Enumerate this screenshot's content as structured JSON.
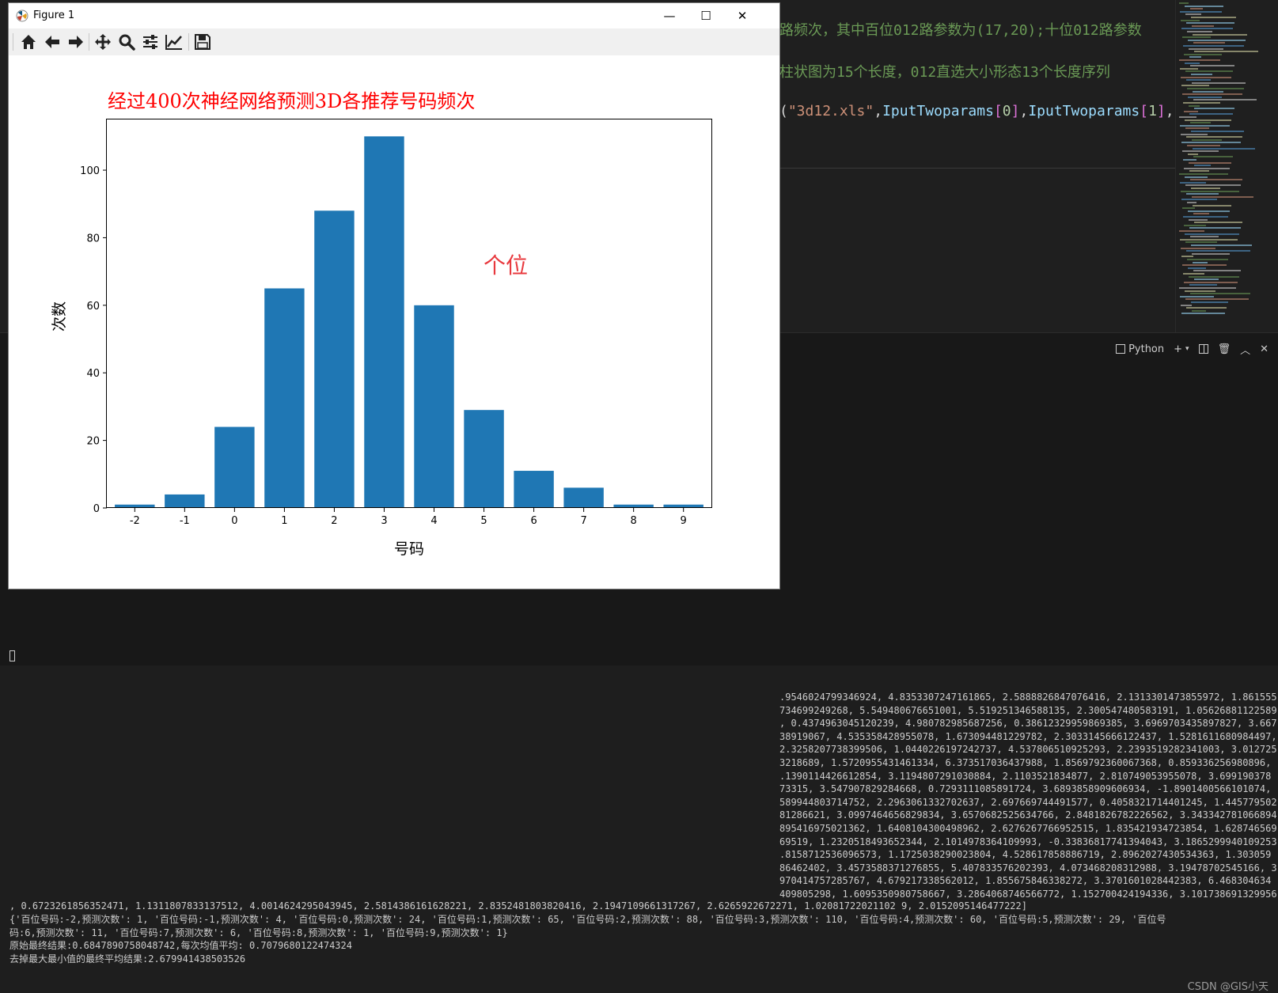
{
  "editor": {
    "comment_line_1": "路频次，其中百位012路参数为(17,20);十位012路参数",
    "comment_line_2": "柱状图为15个长度，012直选大小形态13个长度序列",
    "code_line": {
      "open": "(",
      "str": "\"3d12.xls\"",
      "comma1": ",",
      "var1": "IputTwoparams",
      "idx1_open": "[",
      "idx1": "0",
      "idx1_close": "]",
      "comma2": ",",
      "var2": "IputTwoparams",
      "idx2_open": "[",
      "idx2": "1",
      "idx2_close": "]",
      "tail": ","
    }
  },
  "terminal": {
    "profile_label": "Python",
    "values_lines": [
      ".9546024799346924, 4.8353307247161865, 2.5888826847076416, 2.1313301473855972, 1.861555",
      "734699249268, 5.549480676651001, 5.519251346588135, 2.300547480583191, 1.05626881122589",
      ", 0.4374963045120239, 4.980782985687256, 0.38612329959869385, 3.6969703435897827, 3.667",
      "38919067, 4.535358428955078, 1.673094481229782, 2.3033145666122437, 1.5281611680984497,",
      "2.3258207738399506, 1.0440226197242737, 4.537806510925293, 2.2393519282341003, 3.012725",
      "3218689, 1.5720955431461334, 6.373517036437988, 1.8569792360067368, 0.859336256980896,",
      ".1390114426612854, 3.1194807291030884, 2.1103521834877, 2.810749053955078, 3.699190378",
      "73315, 3.547907829284668, 0.7293111085891724, 3.6893858909606934, -1.8901400566101074,",
      "589944803714752, 2.2963061332702637, 2.697669744491577, 0.4058321714401245, 1.445779502",
      "81286621, 3.0997464656829834, 3.6570682525634766, 2.8481826782226562, 3.343342781066894",
      "895416975021362, 1.6408104300498962, 2.6276267766952515, 1.835421934723854, 1.628746569",
      "69519, 1.2320518493652344, 2.1014978364109993, -0.33836817741394043, 3.1865299940109253",
      ".8158712536096573, 1.1725038290023804, 4.528617858886719, 2.8962027430534363, 1.303059",
      "86462402, 3.4573588371276855, 5.407833576202393, 4.073468208312988, 3.19478702545166, 3",
      "970414757285767, 4.679217338562012, 1.855675846338272, 3.3701601028442383, 6.468304634",
      "409805298, 1.6095350980758667, 3.2864068746566772, 1.152700424194336, 3.101738691329956"
    ],
    "full_lines": [
      ", 0.6723261856352471, 1.1311807833137512, 4.0014624295043945, 2.5814386161628221, 2.8352481803820416, 2.1947109661317267, 2.6265922672271, 1.02081722021102 9, 2.0152095146477222]",
      "{'百位号码:-2,预测次数': 1, '百位号码:-1,预测次数': 4, '百位号码:0,预测次数': 24, '百位号码:1,预测次数': 65, '百位号码:2,预测次数': 88, '百位号码:3,预测次数': 110, '百位号码:4,预测次数': 60, '百位号码:5,预测次数': 29, '百位号",
      "码:6,预测次数': 11, '百位号码:7,预测次数': 6, '百位号码:8,预测次数': 1, '百位号码:9,预测次数': 1}",
      "原始最终结果:0.6847890758048742,每次均值平均: 0.7079680122474324",
      "去掉最大最小值的最终平均结果:2.679941438503526"
    ],
    "watermark": "CSDN @GIS小天"
  },
  "figure_window": {
    "title": "Figure 1",
    "minimize": "—",
    "maximize": "☐",
    "close": "✕"
  },
  "toolbar": {
    "icons": [
      "home-icon",
      "back-icon",
      "forward-icon",
      "pan-icon",
      "zoom-icon",
      "configure-subplots-icon",
      "edit-axis-icon",
      "save-icon"
    ]
  },
  "colors": {
    "bar": "#1f77b4",
    "title_red": "#ff0000",
    "annotation_red": "#e8383d",
    "comment_green": "#6a9955"
  },
  "chart_data": {
    "type": "bar",
    "title": "经过400次神经网络预测3D各推荐号码频次",
    "annotation": "个位",
    "xlabel": "号码",
    "ylabel": "次数",
    "categories": [
      "-2",
      "-1",
      "0",
      "1",
      "2",
      "3",
      "4",
      "5",
      "6",
      "7",
      "8",
      "9"
    ],
    "values": [
      1,
      4,
      24,
      65,
      88,
      110,
      60,
      29,
      11,
      6,
      1,
      1
    ],
    "ylim": [
      0,
      115
    ],
    "yticks": [
      0,
      20,
      40,
      60,
      80,
      100
    ],
    "grid": false,
    "legend": "none"
  }
}
